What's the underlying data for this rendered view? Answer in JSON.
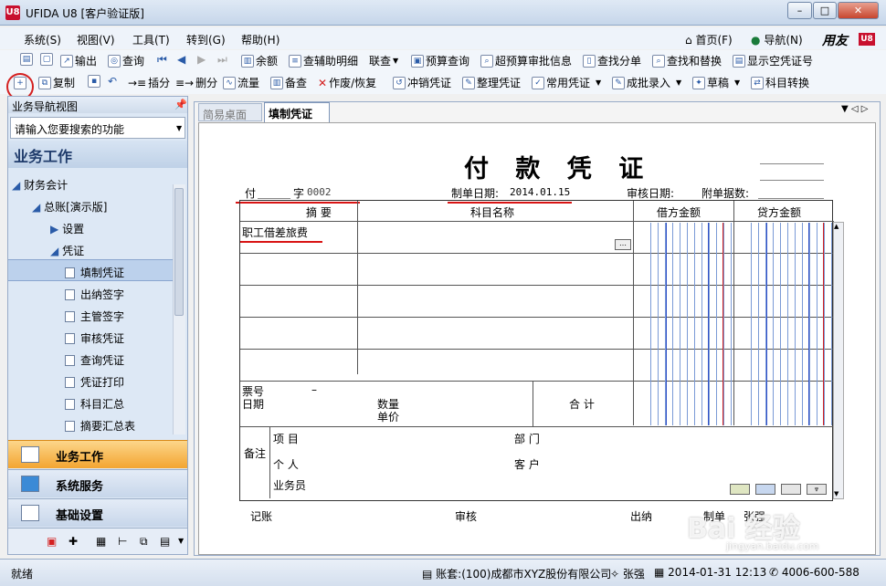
{
  "window": {
    "title": "UFIDA U8 [客户验证版]",
    "logo": "U8",
    "min": "–",
    "max": "□",
    "close": "✕"
  },
  "menu": {
    "items": [
      "系统(S)",
      "视图(V)",
      "工具(T)",
      "转到(G)",
      "帮助(H)"
    ],
    "home": "首页(F)",
    "nav": "导航(N)",
    "brand": "用友"
  },
  "toolbar1": [
    "输出",
    "查询",
    "余额",
    "查辅助明细",
    "联查",
    "预算查询",
    "超预算审批信息",
    "查找分单",
    "查找和替换",
    "显示空凭证号"
  ],
  "toolbar2": [
    "复制",
    "插分",
    "删分",
    "流量",
    "备查",
    "作废/恢复",
    "冲销凭证",
    "整理凭证",
    "常用凭证",
    "成批录入",
    "草稿",
    "科目转换"
  ],
  "nav": {
    "header": "业务导航视图",
    "search_placeholder": "请输入您要搜索的功能",
    "section": "业务工作",
    "tree": [
      "财务会计",
      "总账[演示版]",
      "设置",
      "凭证",
      "填制凭证",
      "出纳签字",
      "主管签字",
      "审核凭证",
      "查询凭证",
      "凭证打印",
      "科目汇总",
      "摘要汇总表"
    ],
    "bottom": [
      "业务工作",
      "系统服务",
      "基础设置"
    ]
  },
  "tabs": [
    "简易桌面",
    "填制凭证"
  ],
  "voucher": {
    "title": "付 款 凭 证",
    "type": "付",
    "zi": "字",
    "number": "0002",
    "date_label": "制单日期:",
    "date": "2014.01.15",
    "audit_date_label": "审核日期:",
    "attach_label": "附单据数:",
    "col_summary": "摘 要",
    "col_account": "科目名称",
    "col_debit": "借方金额",
    "col_credit": "贷方金额",
    "row1_summary": "职工借差旅费",
    "ticket_label": "票号",
    "ticket_dash": "–",
    "date_label2": "日期",
    "qty_label": "数量",
    "price_label": "单价",
    "total_label": "合 计",
    "remark_label": "备注",
    "project_label": "项 目",
    "dept_label": "部 门",
    "person_label": "个 人",
    "customer_label": "客 户",
    "salesman_label": "业务员",
    "sig_book": "记账",
    "sig_audit": "审核",
    "sig_cashier": "出纳",
    "sig_maker": "制单",
    "sig_maker_name": "张强"
  },
  "status": {
    "ready": "就绪",
    "account": "账套:(100)成都市XYZ股份有限公司",
    "user": "张强",
    "datetime": "2014-01-31 12:13",
    "phone": "4006-600-588"
  },
  "watermark": {
    "main": "Bai 经验",
    "url": "jingyan.baidu.com"
  },
  "colors": {
    "accent_red": "#d81414",
    "nav_active": "#f3a531"
  }
}
